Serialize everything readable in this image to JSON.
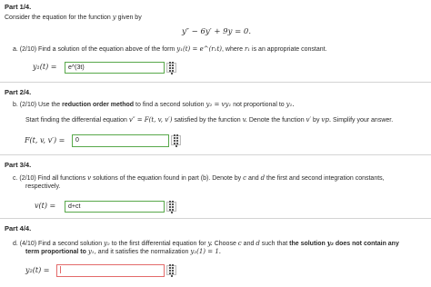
{
  "part1": {
    "title": "Part 1/4.",
    "intro_a": "Consider the equation for the function",
    "intro_var": "y",
    "intro_b": "given by",
    "equation": "y″ − 6y′ + 9y = 0.",
    "q_prefix": "a.",
    "q_points": "(2/10)",
    "q_text_a": "Find a solution of the equation above of the form",
    "q_form": "y₁(t) = e^(r₁t)",
    "q_text_b": ", where",
    "q_r": "r₁",
    "q_text_c": "is an appropriate constant.",
    "answer_label": "y₁(t) =",
    "answer_value": "e^(3t)"
  },
  "part2": {
    "title": "Part 2/4.",
    "q_prefix": "b.",
    "q_points": "(2/10)",
    "q_text_a": "Use the",
    "q_bold": "reduction order method",
    "q_text_b": "to find a second solution",
    "q_form": "y₂ = vy₁",
    "q_text_c": "not proportional to",
    "q_y1": "y₁.",
    "sub_text_a": "Start finding the differential equation",
    "sub_form": "v″ = F(t, v, v′)",
    "sub_text_b": "satisfied by the function",
    "sub_v": "v.",
    "sub_text_c": "Denote the function",
    "sub_vp": "v′",
    "sub_text_d": "by",
    "sub_vp2": "vp.",
    "sub_text_e": "Simplify your answer.",
    "answer_label": "F(t, v, v′) =",
    "answer_value": "0"
  },
  "part3": {
    "title": "Part 3/4.",
    "q_prefix": "c.",
    "q_points": "(2/10)",
    "q_text_a": "Find all functions",
    "q_v": "v",
    "q_text_b": "solutions of the equation found in part (b). Denote by",
    "q_c": "c",
    "q_text_c": "and",
    "q_d": "d",
    "q_text_d": "the first and second integration constants,",
    "q_text_e": "respectively.",
    "answer_label": "v(t) =",
    "answer_value": "d+ct"
  },
  "part4": {
    "title": "Part 4/4.",
    "q_prefix": "d.",
    "q_points": "(4/10)",
    "q_text_a": "Find a second solution",
    "q_y2": "y₂",
    "q_text_b": "to the first differential equation for",
    "q_y": "y.",
    "q_text_c": "Choose",
    "q_c": "c",
    "q_text_d": "and",
    "q_d": "d",
    "q_text_e": "such that",
    "q_bold_a": "the solution",
    "q_bold_y2": "y₂",
    "q_bold_b": "does not contain any",
    "q_bold_c": "term proportional to",
    "q_bold_y1": "y₁,",
    "q_text_f": "and it satisfies the normalization",
    "q_norm": "y₂(1) = 1.",
    "answer_label": "y₂(t) =",
    "answer_value": ""
  },
  "icons": {
    "matrix": "matrix-grid-icon"
  },
  "colors": {
    "valid_border": "#58a84a",
    "error_border": "#e36a6a"
  }
}
